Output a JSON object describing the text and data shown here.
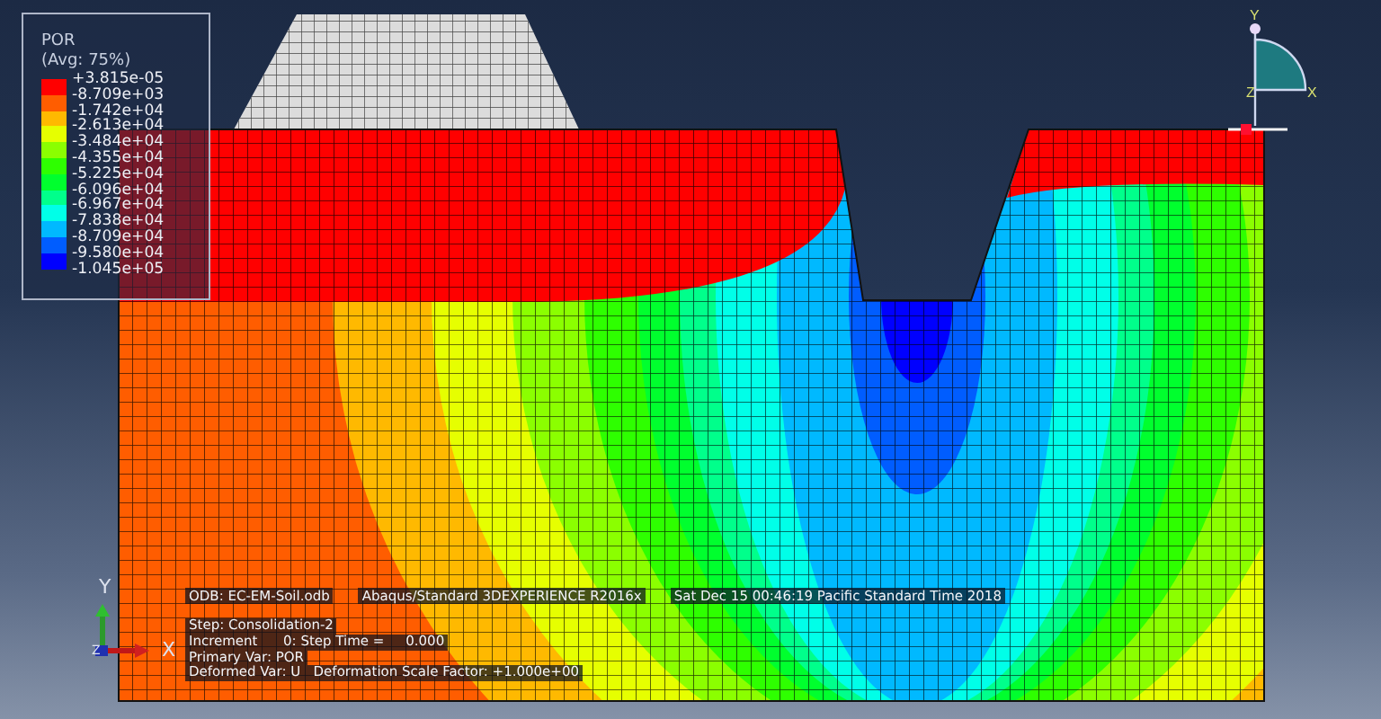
{
  "legend": {
    "title": "POR",
    "subtitle": "(Avg: 75%)",
    "bands": [
      {
        "color": "#ff0000"
      },
      {
        "color": "#ff5d00"
      },
      {
        "color": "#ffb900"
      },
      {
        "color": "#e6ff00"
      },
      {
        "color": "#8bff00"
      },
      {
        "color": "#2eff00"
      },
      {
        "color": "#00ff2e"
      },
      {
        "color": "#00ff8b"
      },
      {
        "color": "#00ffe8"
      },
      {
        "color": "#00b9ff"
      },
      {
        "color": "#005dff"
      },
      {
        "color": "#0000ff"
      }
    ],
    "values": [
      "+3.815e-05",
      "-8.709e+03",
      "-1.742e+04",
      "-2.613e+04",
      "-3.484e+04",
      "-4.355e+04",
      "-5.225e+04",
      "-6.096e+04",
      "-6.967e+04",
      "-7.838e+04",
      "-8.709e+04",
      "-9.580e+04",
      "-1.045e+05"
    ]
  },
  "view_triad": {
    "y_label": "Y",
    "z_label": "Z",
    "x_label": "X"
  },
  "axis_triad": {
    "y_label": "Y",
    "z_label": "Z",
    "x_label": "X"
  },
  "info": {
    "odb": "ODB: EC-EM-Soil.odb",
    "solver": "Abaqus/Standard 3DEXPERIENCE R2016x",
    "date": "Sat Dec 15 00:46:19 Pacific Standard Time 2018",
    "lines": [
      "Step: Consolidation-2",
      "Increment      0: Step Time =     0.000",
      "Primary Var: POR",
      "Deformed Var: U   Deformation Scale Factor: +1.000e+00"
    ]
  }
}
